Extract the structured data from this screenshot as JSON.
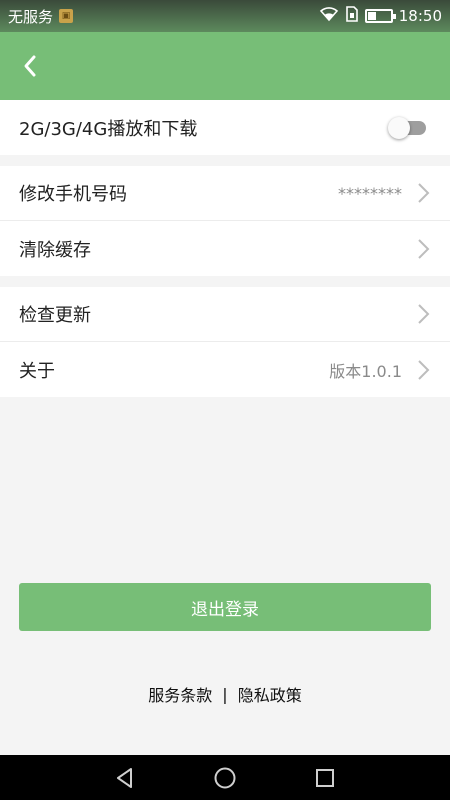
{
  "status_bar": {
    "carrier": "无服务",
    "time": "18:50"
  },
  "settings": {
    "network_play": {
      "label": "2G/3G/4G播放和下载",
      "enabled": false
    },
    "change_phone": {
      "label": "修改手机号码",
      "value": "********"
    },
    "clear_cache": {
      "label": "清除缓存"
    },
    "check_update": {
      "label": "检查更新"
    },
    "about": {
      "label": "关于",
      "value": "版本1.0.1"
    }
  },
  "logout": {
    "label": "退出登录"
  },
  "footer": {
    "terms": "服务条款",
    "separator": "|",
    "privacy": "隐私政策"
  },
  "colors": {
    "header": "#77be77",
    "button": "#77be77",
    "background": "#f4f4f4"
  }
}
